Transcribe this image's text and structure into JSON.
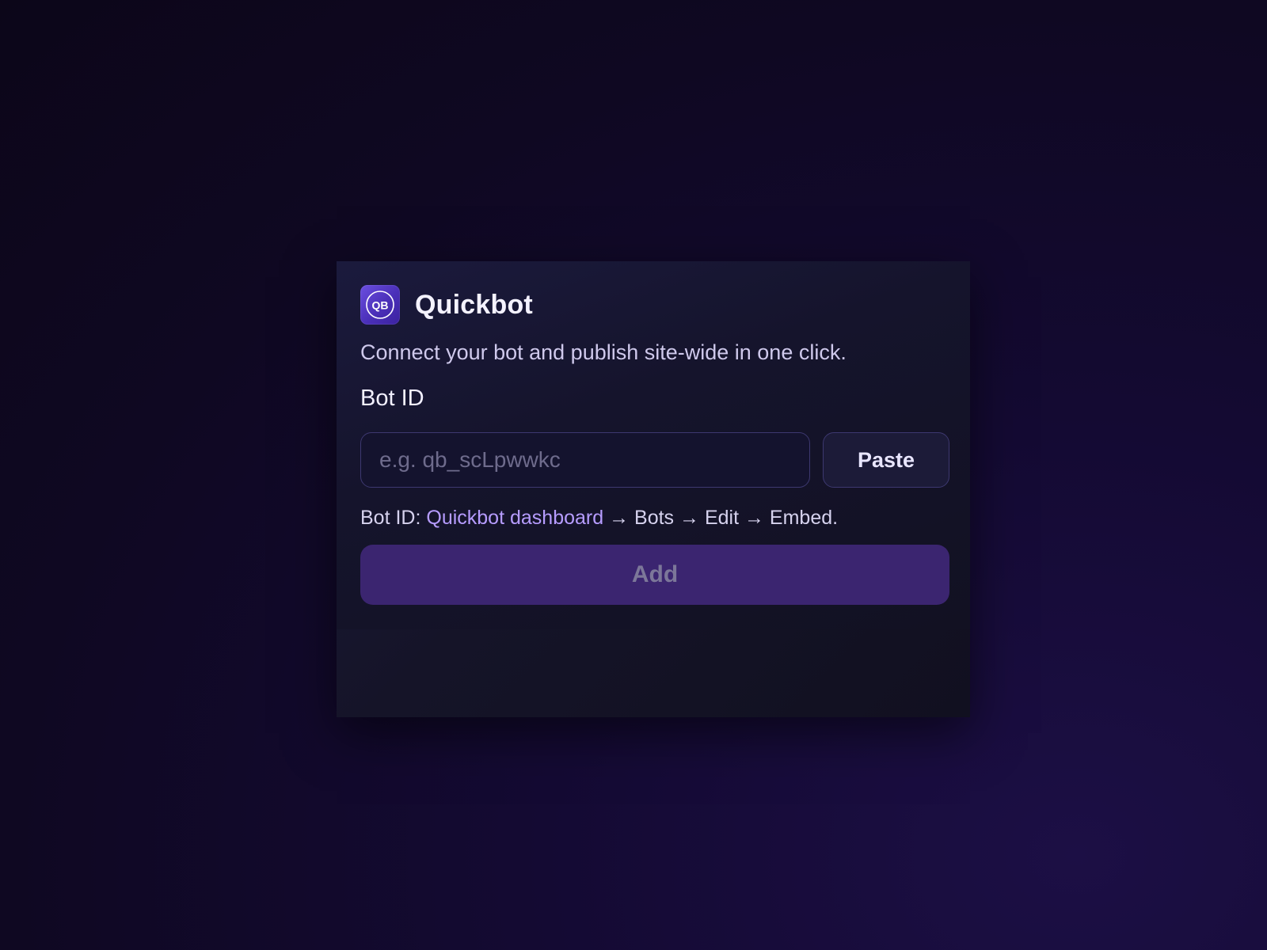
{
  "app": {
    "name": "Quickbot",
    "logo_icon": "quickbot-logo-icon",
    "logo_text": "QB"
  },
  "subtitle": "Connect your bot and publish site-wide in one click.",
  "form": {
    "label": "Bot ID",
    "input_value": "",
    "input_placeholder": "e.g. qb_scLpwwkc",
    "paste_label": "Paste",
    "hint_prefix": "Bot ID: ",
    "hint_link": "Quickbot dashboard",
    "hint_suffix": " → Bots → Edit → Embed.",
    "add_label": "Add"
  },
  "colors": {
    "accent": "#b69cff",
    "logo_start": "#6b4fe0",
    "logo_end": "#3b22a0",
    "add_button_bg": "#3b2570",
    "add_button_text": "#7c7799"
  }
}
